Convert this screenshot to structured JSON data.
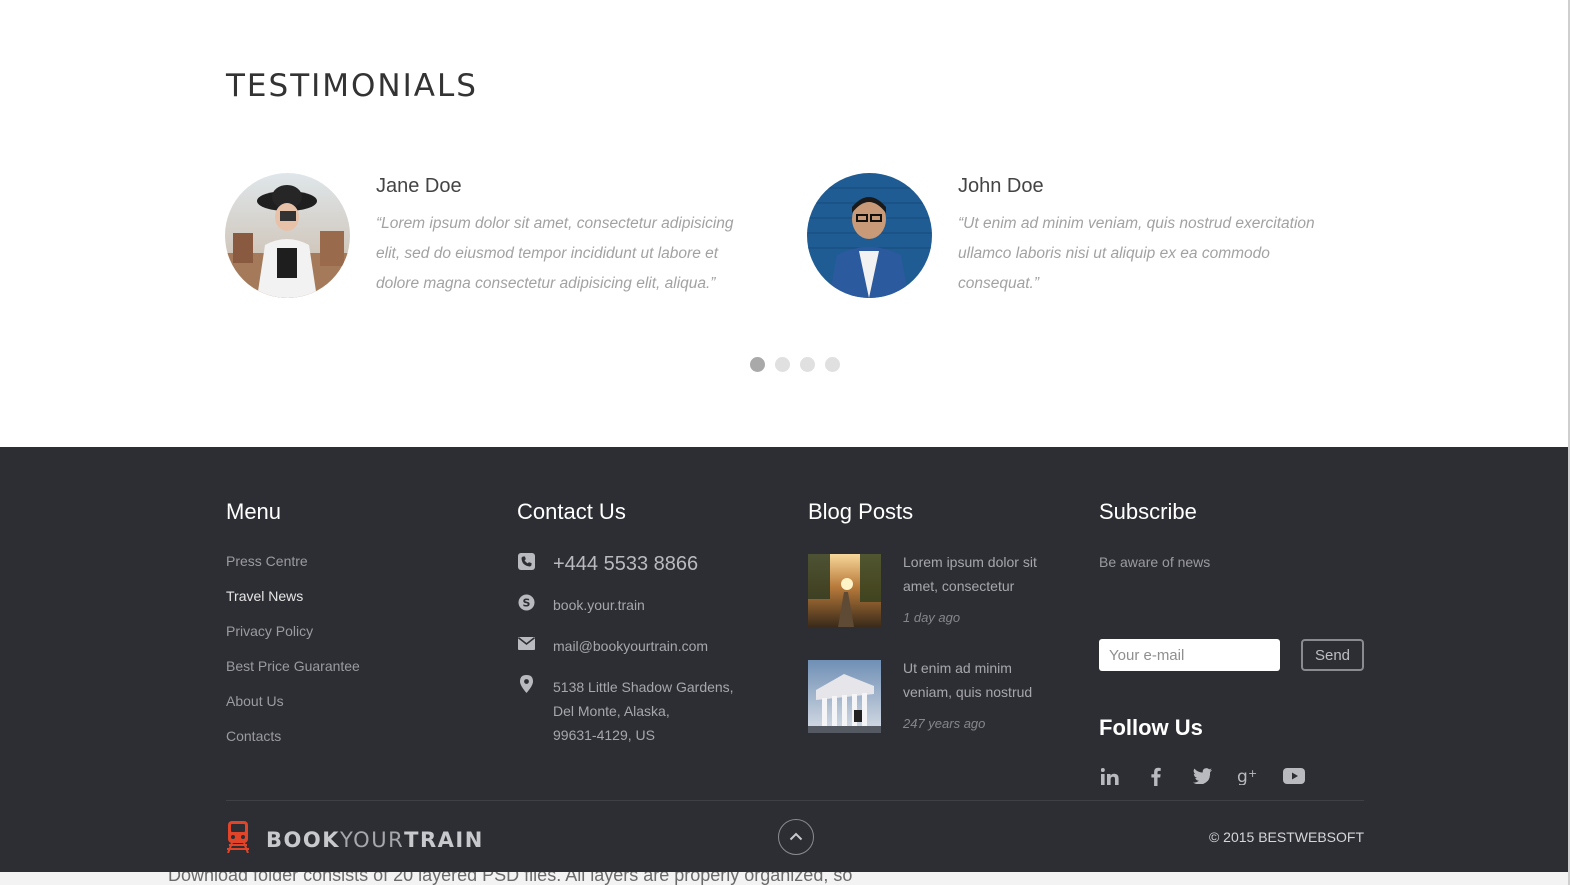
{
  "testimonials": {
    "title": "TESTIMONIALS",
    "items": [
      {
        "name": "Jane Doe",
        "quote": "“Lorem ipsum dolor sit amet, consectetur adipisicing elit, sed do eiusmod tempor incididunt ut labore et dolore magna  consectetur adipisicing elit, aliqua.”"
      },
      {
        "name": "John Doe",
        "quote": "“Ut enim ad minim veniam, quis nostrud exercitation ullamco laboris nisi ut aliquip ex ea commodo consequat.”"
      }
    ],
    "pagination": {
      "pages": 4,
      "active": 1
    }
  },
  "footer": {
    "menu": {
      "heading": "Menu",
      "items": [
        "Press Centre",
        "Travel News",
        "Privacy Policy",
        "Best Price Guarantee",
        "About Us",
        "Contacts"
      ],
      "active_item": "Travel News"
    },
    "contact": {
      "heading": "Contact Us",
      "phone": "+444 5533 8866",
      "skype": "book.your.train",
      "email": "mail@bookyourtrain.com",
      "address_lines": [
        "5138 Little Shadow Gardens,",
        "Del Monte, Alaska,",
        "99631-4129, US"
      ],
      "icons": [
        "phone-icon",
        "skype-icon",
        "mail-icon",
        "location-pin-icon"
      ]
    },
    "blog": {
      "heading": "Blog Posts",
      "posts": [
        {
          "title": "Lorem ipsum dolor sit amet, consectetur",
          "time": "1 day ago"
        },
        {
          "title": "Ut enim ad minim veniam, quis nostrud",
          "time": "247 years ago"
        }
      ]
    },
    "subscribe": {
      "heading": "Subscribe",
      "text": "Be aware of news",
      "placeholder": "Your e-mail",
      "button": "Send",
      "follow_heading": "Follow Us",
      "social": [
        "linkedin-icon",
        "facebook-icon",
        "twitter-icon",
        "google-plus-icon",
        "youtube-icon"
      ]
    },
    "brand": {
      "part1": "BOOK",
      "part2": "YOUR",
      "part3": "TRAIN"
    },
    "copyright": "© 2015 BESTWEBSOFT"
  },
  "bottom_strip": "Download folder consists of 20 layered PSD files. All layers are properly organized, so",
  "colors": {
    "footer_bg": "#2d2e33",
    "brand_accent": "#e0452a"
  }
}
